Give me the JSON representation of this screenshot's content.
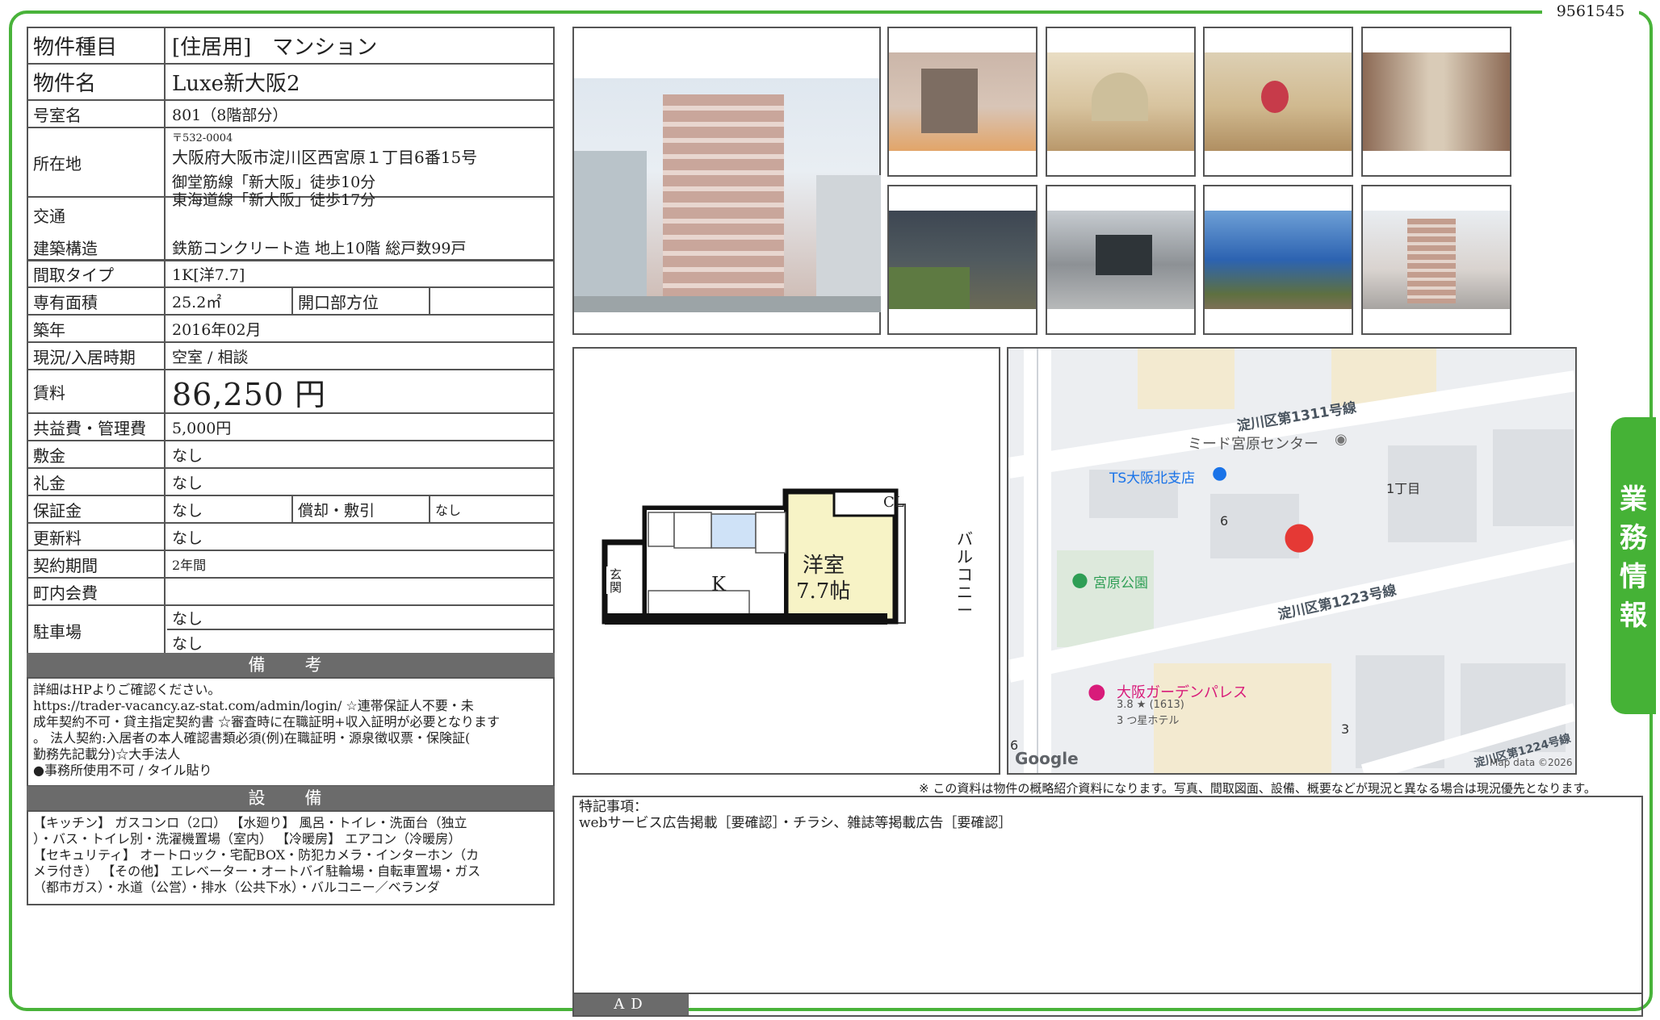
{
  "doc_id": "9561545",
  "side_tab": "業務情報",
  "property": {
    "type_label": "物件種目",
    "type_value": "[住居用]　マンション",
    "name_label": "物件名",
    "name_value": "Luxe新大阪2",
    "room_label": "号室名",
    "room_value": "801（8階部分）",
    "addr_label": "所在地",
    "addr_zip": "〒532-0004",
    "addr_value": "大阪府大阪市淀川区西宮原１丁目6番15号",
    "traffic_label": "交通",
    "traffic_1": "御堂筋線「新大阪」徒歩10分",
    "traffic_2": "東海道線「新大阪」徒歩17分",
    "structure_label": "建築構造",
    "structure_value": "鉄筋コンクリート造 地上10階 総戸数99戸",
    "layout_label": "間取タイプ",
    "layout_value": "1K[洋7.7]",
    "area_label": "専有面積",
    "area_value": "25.2㎡",
    "opening_label": "開口部方位",
    "opening_value": "",
    "built_label": "築年",
    "built_value": "2016年02月",
    "status_label": "現況/入居時期",
    "status_value": "空室 /  相談",
    "rent_label": "賃料",
    "rent_value": "86,250 円",
    "fee_label": "共益費・管理費",
    "fee_value": "5,000円",
    "deposit_label": "敷金",
    "deposit_value": "なし",
    "keymoney_label": "礼金",
    "keymoney_value": "なし",
    "guarantee_label": "保証金",
    "guarantee_value": "なし",
    "amort_label": "償却・敷引",
    "amort_value": "なし",
    "renewal_label": "更新料",
    "renewal_value": "なし",
    "term_label": "契約期間",
    "term_value": "2年間",
    "town_label": "町内会費",
    "town_value": "",
    "parking_label": "駐車場",
    "parking_1": "なし",
    "parking_2": "なし"
  },
  "remarks": {
    "header": "備　考",
    "lines": [
      "詳細はHPよりご確認ください。",
      "https://trader-vacancy.az-stat.com/admin/login/  ☆連帯保証人不要・未",
      "成年契約不可・貸主指定契約書  ☆審査時に在職証明+収入証明が必要となります",
      "。  法人契約:入居者の本人確認書類必須(例)在職証明・源泉徴収票・保険証(",
      "勤務先記載分)☆大手法人",
      "●事務所使用不可 /  タイル貼り"
    ]
  },
  "equipment": {
    "header": "設　備",
    "lines": [
      "【キッチン】 ガスコンロ（2口）  【水廻り】 風呂・トイレ・洗面台（独立",
      "）・バス・トイレ別・洗濯機置場（室内）  【冷暖房】 エアコン（冷暖房）",
      "【セキュリティ】 オートロック・宅配BOX・防犯カメラ・インターホン（カ",
      "メラ付き）  【その他】 エレベーター・オートバイ駐輪場・自転車置場・ガス",
      "（都市ガス）・水道（公営）・排水（公共下水）・バルコニー／ベランダ"
    ]
  },
  "floorplan": {
    "room": "洋室",
    "size": "7.7帖",
    "closet": "CL",
    "kitchen": "K",
    "entrance": "玄関",
    "balcony": "バルコニー"
  },
  "map": {
    "road1": "淀川区第1311号線",
    "road2": "淀川区第1223号線",
    "road3": "淀川区第1224号線",
    "poi1": "ミード宮原センター",
    "poi2": "TS大阪北支店",
    "poi3": "宮原公園",
    "hotel": "大阪ガーデンパレス",
    "hotel_rating": "3.8 ★ (1613)",
    "hotel_class": "3 つ星ホテル",
    "area": "1丁目",
    "block1": "6",
    "block2": "6",
    "block3": "3",
    "google": "Google",
    "copyright": "Map data ©2026"
  },
  "notice": "※ この資料は物件の概略紹介資料になります。写真、間取図面、設備、概要などが現況と異なる場合は現況優先となります。",
  "special": {
    "label": "特記事項：",
    "text": "webサービス広告掲載［要確認］・チラシ、雑誌等掲載広告［要確認］"
  },
  "ad_label": "AD",
  "colors": {
    "frame": "#49b33a",
    "header_bg": "#6b6b6b",
    "pin": "#e53935",
    "park": "#2e9e55",
    "hotel": "#d81b7a",
    "tag": "#1a73e8"
  }
}
